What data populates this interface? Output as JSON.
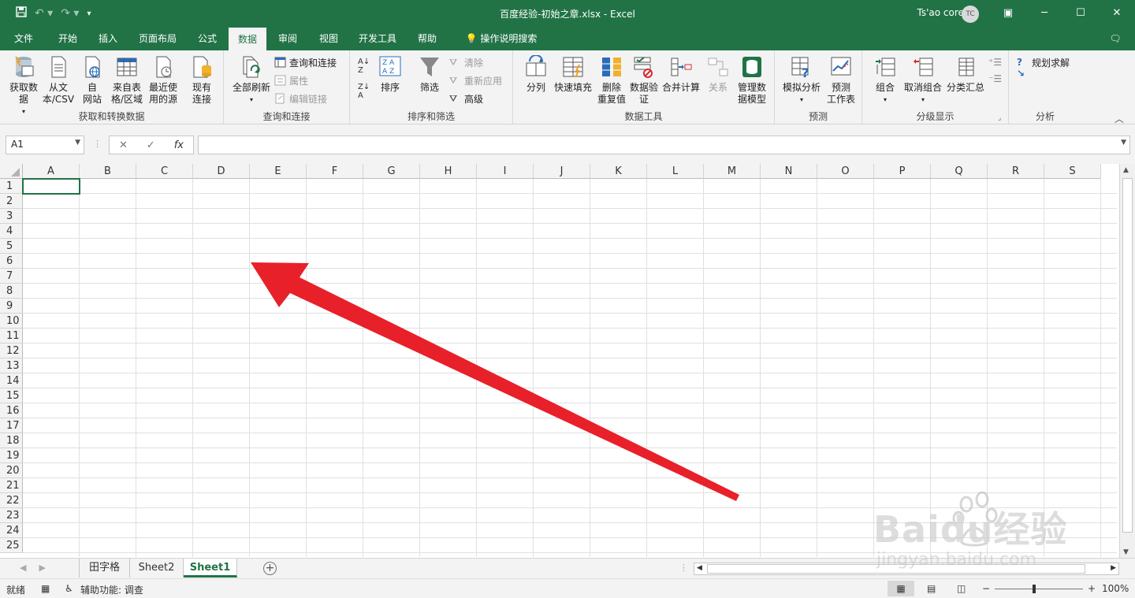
{
  "titlebar": {
    "doc_title": "百度经验-初始之章.xlsx  -  Excel",
    "user_name": "Ts'ao corey",
    "avatar_initials": "TC"
  },
  "menu": {
    "tabs": [
      "文件",
      "开始",
      "插入",
      "页面布局",
      "公式",
      "数据",
      "审阅",
      "视图",
      "开发工具",
      "帮助"
    ],
    "active": "数据",
    "tell_me": "操作说明搜索"
  },
  "ribbon": {
    "get_transform": {
      "label": "获取和转换数据",
      "get_data": "获取数\n据",
      "from_text": "从文\n本/CSV",
      "from_web": "自\n网站",
      "from_table": "来自表\n格/区域",
      "recent": "最近使\n用的源",
      "existing": "现有\n连接"
    },
    "queries": {
      "label": "查询和连接",
      "refresh_all": "全部刷新",
      "queries_conn": "查询和连接",
      "properties": "属性",
      "edit_links": "编辑链接"
    },
    "sort_filter": {
      "label": "排序和筛选",
      "sort": "排序",
      "filter": "筛选",
      "clear": "清除",
      "reapply": "重新应用",
      "advanced": "高级"
    },
    "data_tools": {
      "label": "数据工具",
      "text_to_columns": "分列",
      "flash_fill": "快速填充",
      "remove_dup": "删除\n重复值",
      "validation": "数据验\n证",
      "consolidate": "合并计算",
      "relationships": "关系",
      "data_model": "管理数\n据模型"
    },
    "forecast": {
      "label": "预测",
      "what_if": "模拟分析",
      "sheet": "预测\n工作表"
    },
    "outline": {
      "label": "分级显示",
      "group": "组合",
      "ungroup": "取消组合",
      "subtotal": "分类汇总"
    },
    "analysis": {
      "label": "分析",
      "solver": "规划求解"
    }
  },
  "formula": {
    "name_box": "A1",
    "cancel": "✕",
    "enter": "✓",
    "fx": "fx",
    "content": ""
  },
  "grid": {
    "columns": [
      "A",
      "B",
      "C",
      "D",
      "E",
      "F",
      "G",
      "H",
      "I",
      "J",
      "K",
      "L",
      "M",
      "N",
      "O",
      "P",
      "Q",
      "R",
      "S"
    ],
    "rows": [
      "1",
      "2",
      "3",
      "4",
      "5",
      "6",
      "7",
      "8",
      "9",
      "10",
      "11",
      "12",
      "13",
      "14",
      "15",
      "16",
      "17",
      "18",
      "19",
      "20",
      "21",
      "22",
      "23",
      "24",
      "25"
    ]
  },
  "sheets": {
    "tabs": [
      "田字格",
      "Sheet2",
      "Sheet1"
    ],
    "active": "Sheet1"
  },
  "status": {
    "ready": "就绪",
    "accessibility": "辅助功能: 调查",
    "zoom": "100%"
  },
  "watermark": {
    "brand": "Baidu经验",
    "url": "jingyan.baidu.com"
  },
  "colors": {
    "accent": "#217346",
    "arrow": "#e8202a"
  }
}
